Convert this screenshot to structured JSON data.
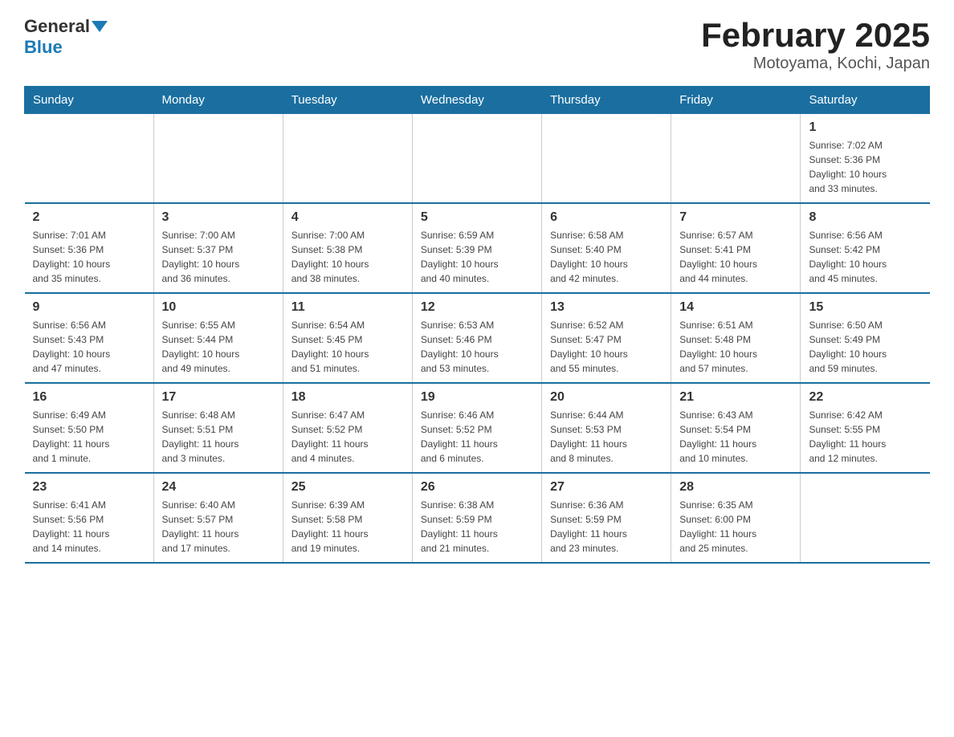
{
  "header": {
    "logo_general": "General",
    "logo_blue": "Blue",
    "title": "February 2025",
    "location": "Motoyama, Kochi, Japan"
  },
  "weekdays": [
    "Sunday",
    "Monday",
    "Tuesday",
    "Wednesday",
    "Thursday",
    "Friday",
    "Saturday"
  ],
  "weeks": [
    [
      {
        "day": "",
        "info": ""
      },
      {
        "day": "",
        "info": ""
      },
      {
        "day": "",
        "info": ""
      },
      {
        "day": "",
        "info": ""
      },
      {
        "day": "",
        "info": ""
      },
      {
        "day": "",
        "info": ""
      },
      {
        "day": "1",
        "info": "Sunrise: 7:02 AM\nSunset: 5:36 PM\nDaylight: 10 hours\nand 33 minutes."
      }
    ],
    [
      {
        "day": "2",
        "info": "Sunrise: 7:01 AM\nSunset: 5:36 PM\nDaylight: 10 hours\nand 35 minutes."
      },
      {
        "day": "3",
        "info": "Sunrise: 7:00 AM\nSunset: 5:37 PM\nDaylight: 10 hours\nand 36 minutes."
      },
      {
        "day": "4",
        "info": "Sunrise: 7:00 AM\nSunset: 5:38 PM\nDaylight: 10 hours\nand 38 minutes."
      },
      {
        "day": "5",
        "info": "Sunrise: 6:59 AM\nSunset: 5:39 PM\nDaylight: 10 hours\nand 40 minutes."
      },
      {
        "day": "6",
        "info": "Sunrise: 6:58 AM\nSunset: 5:40 PM\nDaylight: 10 hours\nand 42 minutes."
      },
      {
        "day": "7",
        "info": "Sunrise: 6:57 AM\nSunset: 5:41 PM\nDaylight: 10 hours\nand 44 minutes."
      },
      {
        "day": "8",
        "info": "Sunrise: 6:56 AM\nSunset: 5:42 PM\nDaylight: 10 hours\nand 45 minutes."
      }
    ],
    [
      {
        "day": "9",
        "info": "Sunrise: 6:56 AM\nSunset: 5:43 PM\nDaylight: 10 hours\nand 47 minutes."
      },
      {
        "day": "10",
        "info": "Sunrise: 6:55 AM\nSunset: 5:44 PM\nDaylight: 10 hours\nand 49 minutes."
      },
      {
        "day": "11",
        "info": "Sunrise: 6:54 AM\nSunset: 5:45 PM\nDaylight: 10 hours\nand 51 minutes."
      },
      {
        "day": "12",
        "info": "Sunrise: 6:53 AM\nSunset: 5:46 PM\nDaylight: 10 hours\nand 53 minutes."
      },
      {
        "day": "13",
        "info": "Sunrise: 6:52 AM\nSunset: 5:47 PM\nDaylight: 10 hours\nand 55 minutes."
      },
      {
        "day": "14",
        "info": "Sunrise: 6:51 AM\nSunset: 5:48 PM\nDaylight: 10 hours\nand 57 minutes."
      },
      {
        "day": "15",
        "info": "Sunrise: 6:50 AM\nSunset: 5:49 PM\nDaylight: 10 hours\nand 59 minutes."
      }
    ],
    [
      {
        "day": "16",
        "info": "Sunrise: 6:49 AM\nSunset: 5:50 PM\nDaylight: 11 hours\nand 1 minute."
      },
      {
        "day": "17",
        "info": "Sunrise: 6:48 AM\nSunset: 5:51 PM\nDaylight: 11 hours\nand 3 minutes."
      },
      {
        "day": "18",
        "info": "Sunrise: 6:47 AM\nSunset: 5:52 PM\nDaylight: 11 hours\nand 4 minutes."
      },
      {
        "day": "19",
        "info": "Sunrise: 6:46 AM\nSunset: 5:52 PM\nDaylight: 11 hours\nand 6 minutes."
      },
      {
        "day": "20",
        "info": "Sunrise: 6:44 AM\nSunset: 5:53 PM\nDaylight: 11 hours\nand 8 minutes."
      },
      {
        "day": "21",
        "info": "Sunrise: 6:43 AM\nSunset: 5:54 PM\nDaylight: 11 hours\nand 10 minutes."
      },
      {
        "day": "22",
        "info": "Sunrise: 6:42 AM\nSunset: 5:55 PM\nDaylight: 11 hours\nand 12 minutes."
      }
    ],
    [
      {
        "day": "23",
        "info": "Sunrise: 6:41 AM\nSunset: 5:56 PM\nDaylight: 11 hours\nand 14 minutes."
      },
      {
        "day": "24",
        "info": "Sunrise: 6:40 AM\nSunset: 5:57 PM\nDaylight: 11 hours\nand 17 minutes."
      },
      {
        "day": "25",
        "info": "Sunrise: 6:39 AM\nSunset: 5:58 PM\nDaylight: 11 hours\nand 19 minutes."
      },
      {
        "day": "26",
        "info": "Sunrise: 6:38 AM\nSunset: 5:59 PM\nDaylight: 11 hours\nand 21 minutes."
      },
      {
        "day": "27",
        "info": "Sunrise: 6:36 AM\nSunset: 5:59 PM\nDaylight: 11 hours\nand 23 minutes."
      },
      {
        "day": "28",
        "info": "Sunrise: 6:35 AM\nSunset: 6:00 PM\nDaylight: 11 hours\nand 25 minutes."
      },
      {
        "day": "",
        "info": ""
      }
    ]
  ]
}
